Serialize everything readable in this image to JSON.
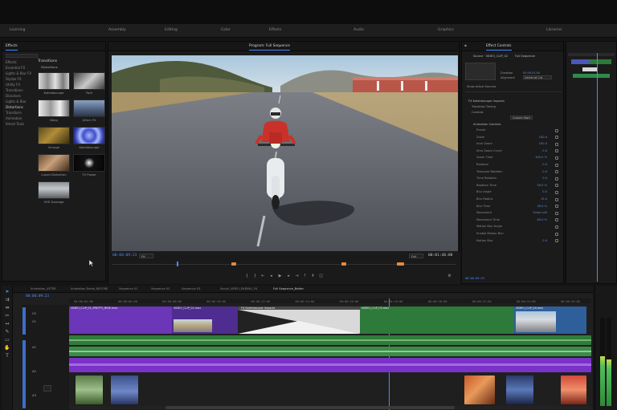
{
  "app": {
    "accent": "#4a8cff",
    "timecode_color": "#4a8cff"
  },
  "menubar": {
    "items": [
      "Learning",
      "Assembly",
      "Editing",
      "Color",
      "Effects",
      "Audio",
      "Graphics",
      "Libraries"
    ]
  },
  "effects_panel": {
    "tab_label": "Effects",
    "tree": [
      "Effects",
      "Essential FX",
      "Lights & Blur FX",
      "Stylize FX",
      "Utility FX",
      "Transitions",
      "Dissolves",
      "Lights & Blur",
      "Distortions",
      "Transform",
      "Animation",
      "Smart Tools"
    ],
    "section_title": "Transitions",
    "section_sub": "Distortions",
    "thumbs": [
      {
        "label": "Kaleidoscope"
      },
      {
        "label": "Twirl"
      },
      {
        "label": "Warp"
      },
      {
        "label": "Glitch FX"
      },
      {
        "label": "Grunge"
      },
      {
        "label": "Kaleidoscope"
      },
      {
        "label": "Liquid Distortion"
      },
      {
        "label": "TV Power"
      },
      {
        "label": "VHS Damage"
      }
    ]
  },
  "monitor": {
    "tab_label": "Program: Full Sequence",
    "timecode_left": "00:00:09:23",
    "zoom": "Fit",
    "quality": "Full",
    "timecode_right": "00:01:46:08"
  },
  "effect_controls": {
    "tab_label": "Effect Controls",
    "source": "Source · VIDEO_CLIP_02",
    "sequence": "Full Sequence",
    "duration_label": "Duration",
    "duration_value": "00:00:01:00",
    "alignment_label": "Alignment",
    "alignment_value": "Center at Cut",
    "reverse_label": "Show Actual Sources",
    "section": "FX Kaleidoscope Impacts",
    "sub1": "Transition Timing",
    "sub2": "Controls",
    "reset_label": "Custom Start",
    "group": "Animation Controls",
    "rows": [
      {
        "name": "Preset",
        "value": ""
      },
      {
        "name": "Zoom",
        "value": "100.0"
      },
      {
        "name": "Intro Zoom",
        "value": "100.0"
      },
      {
        "name": "Intro Zoom Curve",
        "value": "0.0"
      },
      {
        "name": "Zoom Time",
        "value": "100.0 %"
      },
      {
        "name": "Rotation",
        "value": "0.0"
      },
      {
        "name": "Temporal Rotation",
        "value": "0.0"
      },
      {
        "name": "Time Rotation",
        "value": "0.0"
      },
      {
        "name": "Rotation Time",
        "value": "50.0 %"
      },
      {
        "name": "Blur Angle",
        "value": "0.0"
      },
      {
        "name": "Blur Radius",
        "value": "15.0"
      },
      {
        "name": "Blur Time",
        "value": "30.0 %"
      },
      {
        "name": "Movement",
        "value": "Scale Left"
      },
      {
        "name": "Movement Time",
        "value": "80.0 %"
      },
      {
        "name": "Motion Blur Angle",
        "value": ""
      },
      {
        "name": "Enable Motion Blur",
        "value": ""
      },
      {
        "name": "Motion Blur",
        "value": "0.0"
      }
    ],
    "bottom_timecode": "00:00:09:23"
  },
  "timeline": {
    "sequence_tabs": [
      "Animation_AFTER",
      "Animation Demo_BEFORE",
      "Sequence 01",
      "Sequence 02",
      "Sequence 03",
      "Social_VIDEO_ENDING_FX",
      "Full Sequence_Better"
    ],
    "timecode": "00:00:09:23",
    "ruler_ticks": [
      "00:00:04:00",
      "00:00:06:00",
      "00:00:08:00",
      "00:00:10:00",
      "00:00:12:00",
      "00:00:14:00",
      "00:00:16:00",
      "00:00:18:00",
      "00:00:20:00",
      "00:00:22:00",
      "00:00:24:00",
      "00:00:26:00"
    ],
    "track_labels": [
      "V2",
      "V1",
      "A1",
      "A2",
      "A3"
    ],
    "clips": [
      {
        "label": "VIDEO_CLIP_01_PRETTY_RIDE.mov"
      },
      {
        "label": "VIDEO_CLIP_02.mov"
      },
      {
        "label": "FX Kaleidoscope Impacts"
      },
      {
        "label": "VIDEO_CLIP_03.mov"
      },
      {
        "label": "VIDEO_CLIP_04.mov"
      }
    ]
  }
}
